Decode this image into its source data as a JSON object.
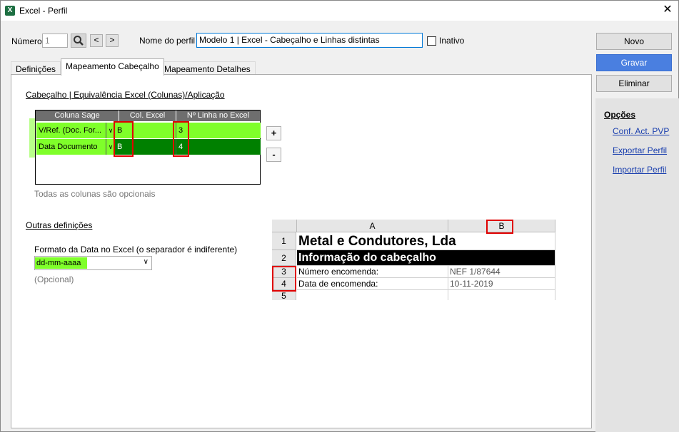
{
  "window": {
    "title": "Excel - Perfil",
    "app_icon": "excel-icon",
    "close_glyph": "✕"
  },
  "header": {
    "numero_label": "Número",
    "numero_value": "1",
    "search_icon": "search-icon",
    "prev_label": "<",
    "next_label": ">",
    "nome_label": "Nome do perfil",
    "nome_value": "Modelo 1 | Excel - Cabeçalho e Linhas distintas",
    "inativo_label": "Inativo"
  },
  "tabs": [
    {
      "label": "Definições",
      "active": false
    },
    {
      "label": "Mapeamento Cabeçalho",
      "active": true
    },
    {
      "label": "Mapeamento Detalhes",
      "active": false
    }
  ],
  "mapping": {
    "section_title": "Cabeçalho | Equivalência Excel (Colunas)/Aplicação",
    "columns": [
      "Coluna Sage",
      "Col. Excel",
      "Nº Linha no Excel"
    ],
    "rows": [
      {
        "sage": "V/Ref. (Doc. For...",
        "col": "B",
        "line": "3"
      },
      {
        "sage": "Data Documento",
        "col": "B",
        "line": "4"
      }
    ],
    "add_label": "+",
    "remove_label": "-",
    "note": "Todas as colunas são opcionais",
    "highlight_color": "#7fff2a",
    "selected_row_color": "#008000"
  },
  "other": {
    "section_title": "Outras definições",
    "date_format_label": "Formato da Data no Excel (o separador é indiferente)",
    "date_format_value": "dd-mm-aaaa",
    "optional_label": "(Opcional)"
  },
  "excel_preview": {
    "col_a": "A",
    "col_b": "B",
    "rows": [
      {
        "n": "1",
        "a": "Metal e Condutores, Lda",
        "b": ""
      },
      {
        "n": "2",
        "a": "Informação do cabeçalho",
        "b": ""
      },
      {
        "n": "3",
        "a": "Número encomenda:",
        "b": "NEF 1/87644"
      },
      {
        "n": "4",
        "a": "Data de encomenda:",
        "b": "10-11-2019"
      },
      {
        "n": "5",
        "a": "",
        "b": ""
      }
    ]
  },
  "sidebar": {
    "novo": "Novo",
    "gravar": "Gravar",
    "eliminar": "Eliminar",
    "options_title": "Opções",
    "links": [
      "Conf. Act. PVP",
      "Exportar Perfil",
      "Importar Perfil"
    ]
  }
}
